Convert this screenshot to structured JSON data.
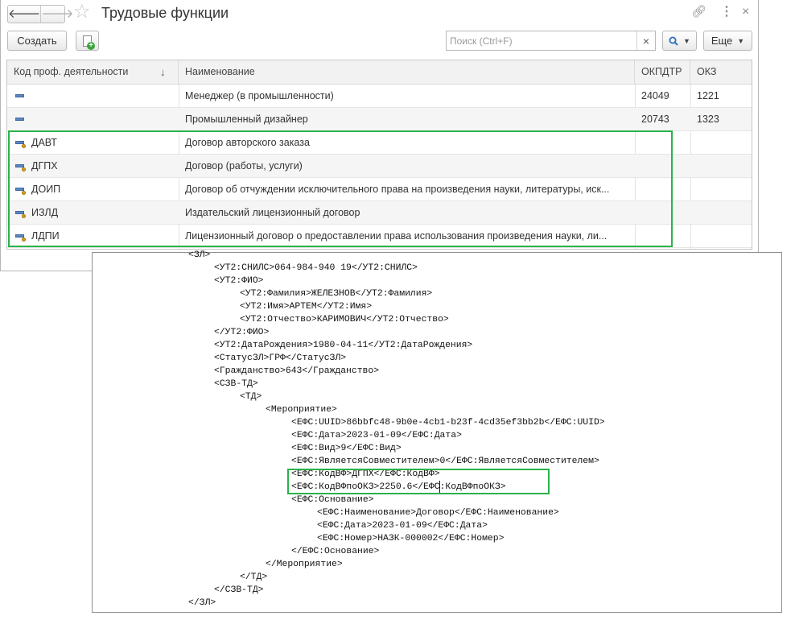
{
  "window": {
    "title": "Трудовые функции",
    "nav_back": "🡐",
    "nav_forward": "🡒"
  },
  "toolbar": {
    "create_label": "Создать",
    "search_placeholder": "Поиск (Ctrl+F)",
    "search_value": "",
    "clear_label": "×",
    "more_label": "Еще"
  },
  "table": {
    "columns": [
      "Код проф. деятельности",
      "Наименование",
      "ОКПДТР",
      "ОКЗ"
    ],
    "rows": [
      {
        "code": "",
        "name": "Менеджер (в промышленности)",
        "okpdtr": "24049",
        "okz": "1221",
        "icon": "item-icon"
      },
      {
        "code": "",
        "name": "Промышленный дизайнер",
        "okpdtr": "20743",
        "okz": "1323",
        "icon": "item-icon"
      },
      {
        "code": "ДАВТ",
        "name": "Договор авторского заказа",
        "okpdtr": "",
        "okz": "",
        "icon": "item-key-icon"
      },
      {
        "code": "ДГПХ",
        "name": "Договор (работы, услуги)",
        "okpdtr": "",
        "okz": "",
        "icon": "item-key-icon"
      },
      {
        "code": "ДОИП",
        "name": "Договор об отчуждении исключительного права на произведения науки, литературы, иск...",
        "okpdtr": "",
        "okz": "",
        "icon": "item-key-icon"
      },
      {
        "code": "ИЗЛД",
        "name": "Издательский лицензионный договор",
        "okpdtr": "",
        "okz": "",
        "icon": "item-key-icon"
      },
      {
        "code": "ЛДПИ",
        "name": "Лицензионный договор о предоставлении права использования произведения науки, ли...",
        "okpdtr": "",
        "okz": "",
        "icon": "item-key-icon"
      }
    ]
  },
  "xml": {
    "lines": [
      "<ЗЛ>",
      "<УТ2:СНИЛС>064-984-940 19</УТ2:СНИЛС>",
      "<УТ2:ФИО>",
      "<УТ2:Фамилия>ЖЕЛЕЗНОВ</УТ2:Фамилия>",
      "<УТ2:Имя>АРТЕМ</УТ2:Имя>",
      "<УТ2:Отчество>КАРИМОВИЧ</УТ2:Отчество>",
      "</УТ2:ФИО>",
      "<УТ2:ДатаРождения>1980-04-11</УТ2:ДатаРождения>",
      "<СтатусЗЛ>ГРФ</СтатусЗЛ>",
      "<Гражданство>643</Гражданство>",
      "<СЗВ-ТД>",
      "<ТД>",
      "<Мероприятие>",
      "<ЕФС:UUID>86bbfc48-9b0e-4cb1-b23f-4cd35ef3bb2b</ЕФС:UUID>",
      "<ЕФС:Дата>2023-01-09</ЕФС:Дата>",
      "<ЕФС:Вид>9</ЕФС:Вид>",
      "<ЕФС:ЯвляетсяСовместителем>0</ЕФС:ЯвляетсяСовместителем>",
      "<ЕФС:КодВФ>ДГПХ</ЕФС:КодВФ>",
      "<ЕФС:КодВФпоОКЗ>2250.6</ЕФС:КодВФпоОКЗ>",
      "<ЕФС:Основание>",
      "<ЕФС:Наименование>Договор</ЕФС:Наименование>",
      "<ЕФС:Дата>2023-01-09</ЕФС:Дата>",
      "<ЕФС:Номер>НАЗК-000002</ЕФС:Номер>",
      "</ЕФС:Основание>",
      "</Мероприятие>",
      "</ТД>",
      "</СЗВ-ТД>",
      "</ЗЛ>"
    ]
  }
}
